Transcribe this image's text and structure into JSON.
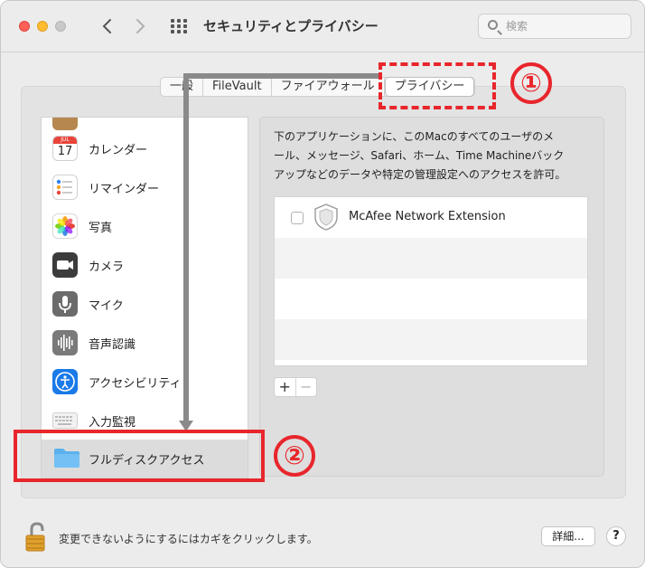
{
  "window": {
    "title": "セキュリティとプライバシー",
    "nav_back": "‹",
    "nav_forward": "›"
  },
  "search": {
    "placeholder": "検索"
  },
  "tabs": [
    {
      "label": "一般",
      "active": false
    },
    {
      "label": "FileVault",
      "active": false
    },
    {
      "label": "ファイアウォール",
      "active": false
    },
    {
      "label": "プライバシー",
      "active": true
    }
  ],
  "sidebar": {
    "items": [
      {
        "label": "",
        "icon": "contacts-icon"
      },
      {
        "label": "カレンダー",
        "icon": "calendar-icon",
        "calendar_month": "JUL",
        "calendar_day": "17"
      },
      {
        "label": "リマインダー",
        "icon": "reminders-icon"
      },
      {
        "label": "写真",
        "icon": "photos-icon"
      },
      {
        "label": "カメラ",
        "icon": "camera-icon"
      },
      {
        "label": "マイク",
        "icon": "microphone-icon"
      },
      {
        "label": "音声認識",
        "icon": "speech-recognition-icon"
      },
      {
        "label": "アクセシビリティ",
        "icon": "accessibility-icon"
      },
      {
        "label": "入力監視",
        "icon": "keyboard-icon"
      },
      {
        "label": "フルディスクアクセス",
        "icon": "folder-icon",
        "selected": true
      }
    ]
  },
  "content": {
    "description_lines": [
      "下のアプリケーションに、このMacのすべてのユーザのメ",
      "ール、メッセージ、Safari、ホーム、Time Machineバック",
      "アップなどのデータや特定の管理設定へのアクセスを許可。"
    ],
    "apps": [
      {
        "name": "McAfee Network Extension",
        "checked": false,
        "icon": "shield-icon"
      }
    ],
    "add_label": "+",
    "remove_label": "−"
  },
  "footer": {
    "lock_text": "変更できないようにするにはカギをクリックします。",
    "details_label": "詳細...",
    "help_label": "?"
  },
  "annotations": {
    "step1": "①",
    "step2": "②",
    "color": "#e8262c"
  }
}
